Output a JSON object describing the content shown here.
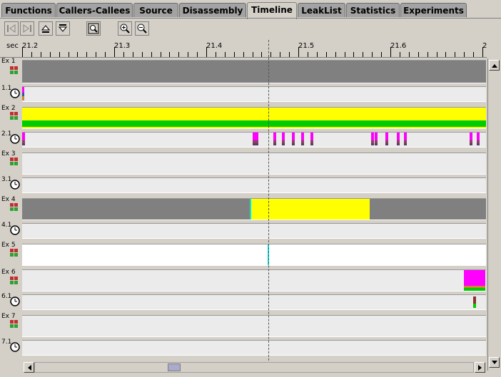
{
  "tabs": [
    {
      "label": "Functions",
      "active": false
    },
    {
      "label": "Callers-Callees",
      "active": false
    },
    {
      "label": "Source",
      "active": false
    },
    {
      "label": "Disassembly",
      "active": false
    },
    {
      "label": "Timeline",
      "active": true
    },
    {
      "label": "LeakList",
      "active": false
    },
    {
      "label": "Statistics",
      "active": false
    },
    {
      "label": "Experiments",
      "active": false
    }
  ],
  "toolbar": {
    "buttons": [
      {
        "name": "step-back-icon",
        "enabled": false
      },
      {
        "name": "step-forward-icon",
        "enabled": false
      },
      {
        "name": "scroll-up-icon",
        "enabled": true
      },
      {
        "name": "scroll-down-icon",
        "enabled": true
      },
      {
        "name": "zoom-reset-icon",
        "enabled": true
      },
      {
        "name": "zoom-in-icon",
        "enabled": true
      },
      {
        "name": "zoom-out-icon",
        "enabled": true
      }
    ]
  },
  "ruler": {
    "unit": "sec",
    "labels": [
      "21.2",
      "21.3",
      "21.4",
      "21.5",
      "21.6",
      "2"
    ]
  },
  "rows": [
    {
      "label": "Ex 1",
      "kind": "exp",
      "icon": "experiment-icon"
    },
    {
      "label": "1.1",
      "kind": "thread",
      "icon": "clock-icon"
    },
    {
      "label": "Ex 2",
      "kind": "exp",
      "icon": "experiment-icon"
    },
    {
      "label": "2.1",
      "kind": "thread",
      "icon": "clock-icon"
    },
    {
      "label": "Ex 3",
      "kind": "exp",
      "icon": "experiment-icon"
    },
    {
      "label": "3.1",
      "kind": "thread",
      "icon": "clock-icon"
    },
    {
      "label": "Ex 4",
      "kind": "exp",
      "icon": "experiment-icon"
    },
    {
      "label": "4.1",
      "kind": "thread",
      "icon": "clock-icon"
    },
    {
      "label": "Ex 5",
      "kind": "exp",
      "icon": "experiment-icon"
    },
    {
      "label": "Ex 6",
      "kind": "exp",
      "icon": "experiment-icon"
    },
    {
      "label": "6.1",
      "kind": "thread",
      "icon": "clock-icon"
    },
    {
      "label": "Ex 7",
      "kind": "exp",
      "icon": "experiment-icon"
    },
    {
      "label": "7.1",
      "kind": "thread",
      "icon": "clock-icon"
    }
  ],
  "colors": {
    "gray": "#808080",
    "yellow": "#ffff00",
    "green": "#00cc00",
    "magenta": "#ff00ff",
    "cyan": "#00e5e5",
    "pink": "#cc3377",
    "brown": "#8a5a2a",
    "white": "#ffffff"
  }
}
